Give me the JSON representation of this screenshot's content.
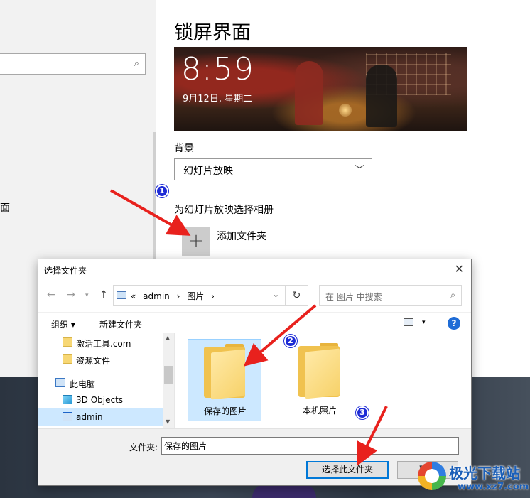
{
  "settings": {
    "page_title": "锁屏界面",
    "left_partial_text": "面",
    "preview": {
      "time": "8:59",
      "date": "9月12日, 星期二"
    },
    "background_label": "背景",
    "background_value": "幻灯片放映",
    "album_label": "为幻灯片放映选择相册",
    "add_folder_label": "添加文件夹"
  },
  "dialog": {
    "title": "选择文件夹",
    "breadcrumb": [
      "«",
      "admin",
      "›",
      "图片",
      "›"
    ],
    "search_placeholder": "在 图片 中搜索",
    "toolbar": {
      "organize": "组织 ▾",
      "new_folder": "新建文件夹"
    },
    "nav_items": [
      {
        "label": "激活工具.com",
        "icon": "folder-icon"
      },
      {
        "label": "资源文件",
        "icon": "folder-icon"
      },
      {
        "label": "此电脑",
        "icon": "computer-icon"
      },
      {
        "label": "3D Objects",
        "icon": "3d-objects-icon"
      },
      {
        "label": "admin",
        "icon": "desktop-icon",
        "selected": true
      }
    ],
    "files": [
      {
        "label": "保存的图片",
        "selected": true
      },
      {
        "label": "本机照片",
        "selected": false
      }
    ],
    "filename_label": "文件夹:",
    "filename_value": "保存的图片",
    "select_button": "选择此文件夹",
    "cancel_button": "取消"
  },
  "annotations": {
    "markers": [
      "1",
      "2",
      "3"
    ],
    "arrow_color": "#e8211d",
    "marker_color": "#1d2bd6"
  },
  "watermark": {
    "name": "极光下载站",
    "url": "www.xz7.com"
  }
}
